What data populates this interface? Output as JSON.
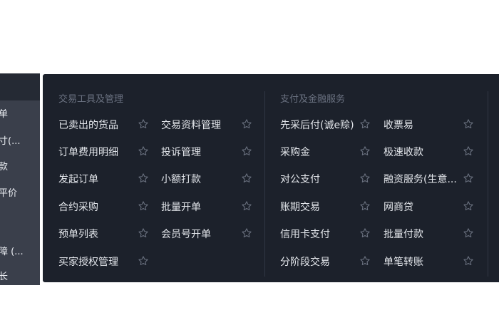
{
  "sidebar": {
    "items": [
      {
        "label": "单"
      },
      {
        "label": "寸(..."
      },
      {
        "label": "款"
      },
      {
        "label": "平价"
      },
      {
        "label": "障 (..."
      },
      {
        "label": "长"
      }
    ]
  },
  "panel": {
    "left_section": {
      "title": "交易工具及管理",
      "col1": [
        "已卖出的货品",
        "订单费用明细",
        "发起订单",
        "合约采购",
        "预单列表",
        "买家授权管理"
      ],
      "col2": [
        "交易资料管理",
        "投诉管理",
        "小额打款",
        "批量开单",
        "会员号开单"
      ]
    },
    "right_section": {
      "title": "支付及金融服务",
      "col1": [
        "先采后付(诚e赊)",
        "采购金",
        "对公支付",
        "账期交易",
        "信用卡支付",
        "分阶段交易"
      ],
      "col2": [
        "收票易",
        "极速收款",
        "融资服务(生意...",
        "网商贷",
        "批量付款",
        "单笔转账"
      ]
    }
  },
  "icons": {
    "favorite": "star-outline-icon"
  },
  "colors": {
    "panel_bg": "#1c212b",
    "item_text": "#e3e6eb",
    "section_title": "#6a7180",
    "star": "#6b7280"
  }
}
